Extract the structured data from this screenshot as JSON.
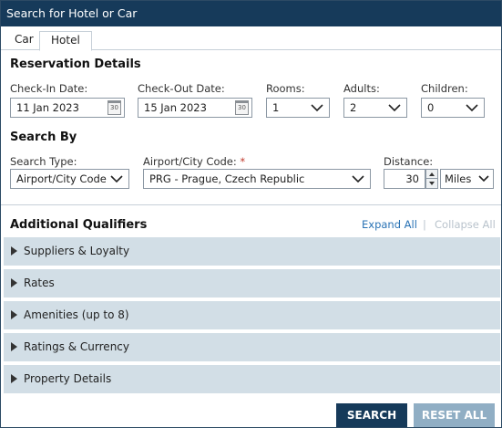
{
  "window": {
    "title": "Search for Hotel or Car"
  },
  "tabs": [
    {
      "label": "Car"
    },
    {
      "label": "Hotel"
    }
  ],
  "reservation": {
    "title": "Reservation Details",
    "checkin": {
      "label": "Check-In Date:",
      "value": "11 Jan 2023",
      "icon": "calendar-icon",
      "icon_text": "30"
    },
    "checkout": {
      "label": "Check-Out Date:",
      "value": "15 Jan 2023",
      "icon": "calendar-icon",
      "icon_text": "30"
    },
    "rooms": {
      "label": "Rooms:",
      "value": "1"
    },
    "adults": {
      "label": "Adults:",
      "value": "2"
    },
    "children": {
      "label": "Children:",
      "value": "0"
    }
  },
  "search_by": {
    "title": "Search By",
    "type": {
      "label": "Search Type:",
      "value": "Airport/City Code"
    },
    "code": {
      "label": "Airport/City Code:",
      "required_mark": "*",
      "value": "PRG - Prague, Czech Republic"
    },
    "distance": {
      "label": "Distance:",
      "value": "30",
      "unit": "Miles"
    }
  },
  "qualifiers": {
    "title": "Additional Qualifiers",
    "expand_all": "Expand All",
    "separator": "|",
    "collapse_all": "Collapse All",
    "sections": [
      {
        "label": "Suppliers & Loyalty"
      },
      {
        "label": "Rates"
      },
      {
        "label": "Amenities (up to 8)"
      },
      {
        "label": "Ratings & Currency"
      },
      {
        "label": "Property Details"
      }
    ]
  },
  "actions": {
    "search": "SEARCH",
    "reset": "RESET ALL"
  },
  "colors": {
    "titlebar": "#163a5a",
    "accordion": "#d2dee6",
    "link": "#2a73b5",
    "reset_button": "#90aec4"
  }
}
